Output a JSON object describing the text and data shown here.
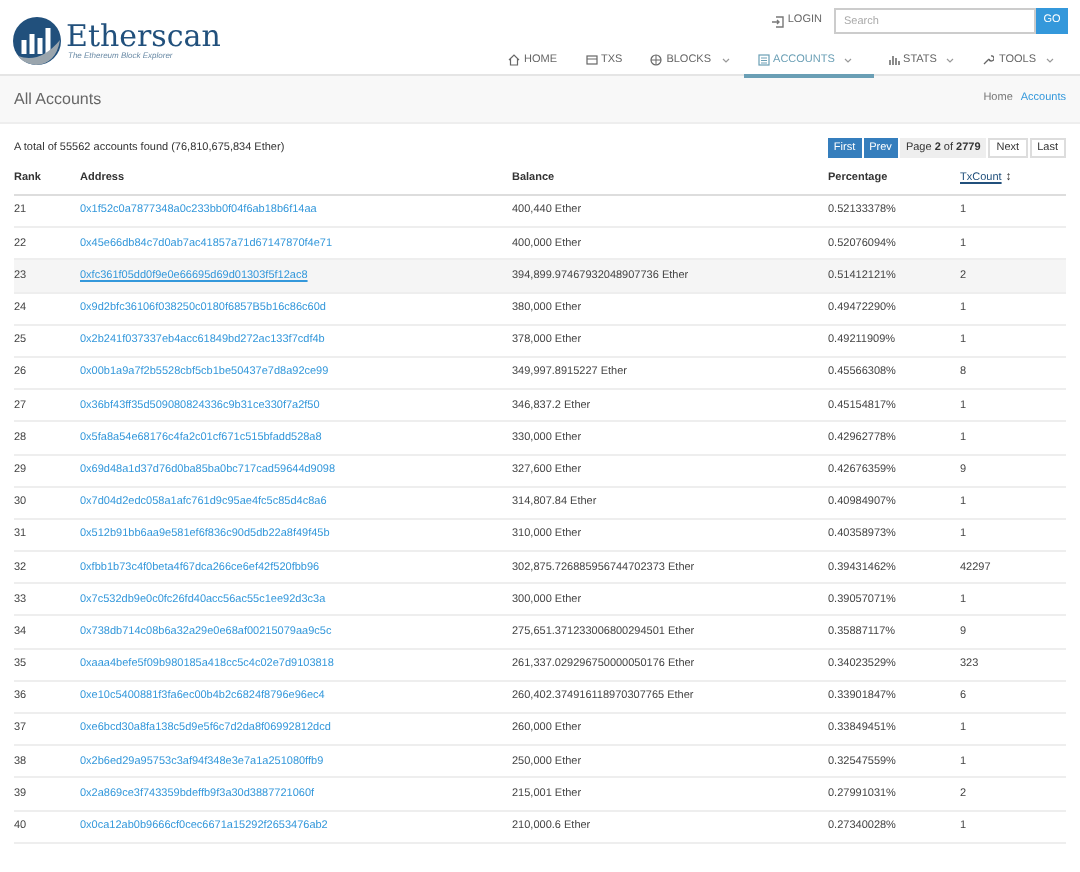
{
  "header": {
    "logo_title": "Etherscan",
    "logo_tagline": "The Ethereum Block Explorer",
    "login": "LOGIN",
    "search": {
      "placeholder": "Search"
    },
    "go": "GO"
  },
  "nav": [
    {
      "label": "HOME",
      "kind": "home",
      "dropdown": false,
      "selected": false
    },
    {
      "label": "TXS",
      "kind": "list",
      "dropdown": false,
      "selected": false
    },
    {
      "label": "BLOCKS",
      "kind": "cube",
      "dropdown": true,
      "selected": false
    },
    {
      "label": "ACCOUNTS",
      "kind": "card",
      "dropdown": true,
      "selected": true
    },
    {
      "label": "STATS",
      "kind": "bars",
      "dropdown": true,
      "selected": false
    },
    {
      "label": "TOOLS",
      "kind": "wrench",
      "dropdown": true,
      "selected": false
    }
  ],
  "page_title": "All Accounts",
  "breadcrumb": [
    "Home",
    "Accounts"
  ],
  "summary": "A total of 55562 accounts found (76,810,675,834 Ether)",
  "pagination": {
    "first": "First",
    "prev": "Prev",
    "page": "Page **2** of **2779**",
    "next": "Next",
    "last": "Last"
  },
  "table": {
    "columns": [
      "Rank",
      "Address",
      "Balance",
      "Percentage",
      "TxCount"
    ],
    "sort_icon": "↕",
    "rows": [
      {
        "rank": "21",
        "address": "0x1f52c0a7877348a0c233bb0f04f6ab18b6f14aa",
        "balance": "400,440 Ether",
        "percentage": "0.52133378%",
        "txcount": "1",
        "selected": false
      },
      {
        "rank": "22",
        "address": "0x45e66db84c7d0ab7ac41857a71d67147870f4e71",
        "balance": "400,000 Ether",
        "percentage": "0.52076094%",
        "txcount": "1",
        "selected": false
      },
      {
        "rank": "23",
        "address": "0xfc361f05dd0f9e0e66695d69d01303f5f12ac8",
        "balance": "394,899.97467932048907736 Ether",
        "percentage": "0.51412121%",
        "txcount": "2",
        "selected": true
      },
      {
        "rank": "24",
        "address": "0x9d2bfc36106f038250c0180f6857B5b16c86c60d",
        "balance": "380,000 Ether",
        "percentage": "0.49472290%",
        "txcount": "1",
        "selected": false
      },
      {
        "rank": "25",
        "address": "0x2b241f037337eb4acc61849bd272ac133f7cdf4b",
        "balance": "378,000 Ether",
        "percentage": "0.49211909%",
        "txcount": "1",
        "selected": false
      },
      {
        "rank": "26",
        "address": "0x00b1a9a7f2b5528cbf5cb1be50437e7d8a92ce99",
        "balance": "349,997.8915227 Ether",
        "percentage": "0.45566308%",
        "txcount": "8",
        "selected": false
      },
      {
        "rank": "27",
        "address": "0x36bf43ff35d509080824336c9b31ce330f7a2f50",
        "balance": "346,837.2 Ether",
        "percentage": "0.45154817%",
        "txcount": "1",
        "selected": false
      },
      {
        "rank": "28",
        "address": "0x5fa8a54e68176c4fa2c01cf671c515bfadd528a8",
        "balance": "330,000 Ether",
        "percentage": "0.42962778%",
        "txcount": "1",
        "selected": false
      },
      {
        "rank": "29",
        "address": "0x69d48a1d37d76d0ba85ba0bc717cad59644d9098",
        "balance": "327,600 Ether",
        "percentage": "0.42676359%",
        "txcount": "9",
        "selected": false
      },
      {
        "rank": "30",
        "address": "0x7d04d2edc058a1afc761d9c95ae4fc5c85d4c8a6",
        "balance": "314,807.84 Ether",
        "percentage": "0.40984907%",
        "txcount": "1",
        "selected": false
      },
      {
        "rank": "31",
        "address": "0x512b91bb6aa9e581ef6f836c90d5db22a8f49f45b",
        "balance": "310,000 Ether",
        "percentage": "0.40358973%",
        "txcount": "1",
        "selected": false
      },
      {
        "rank": "32",
        "address": "0xfbb1b73c4f0beta4f67dca266ce6ef42f520fbb96",
        "balance": "302,875.726885956744702373 Ether",
        "percentage": "0.39431462%",
        "txcount": "42297",
        "selected": false
      },
      {
        "rank": "33",
        "address": "0x7c532db9e0c0fc26fd40acc56ac55c1ee92d3c3a",
        "balance": "300,000 Ether",
        "percentage": "0.39057071%",
        "txcount": "1",
        "selected": false
      },
      {
        "rank": "34",
        "address": "0x738db714c08b6a32a29e0e68af00215079aa9c5c",
        "balance": "275,651.371233006800294501 Ether",
        "percentage": "0.35887117%",
        "txcount": "9",
        "selected": false
      },
      {
        "rank": "35",
        "address": "0xaaa4befe5f09b980185a418cc5c4c02e7d9103818",
        "balance": "261,337.029296750000050176 Ether",
        "percentage": "0.34023529%",
        "txcount": "323",
        "selected": false
      },
      {
        "rank": "36",
        "address": "0xe10c5400881f3fa6ec00b4b2c6824f8796e96ec4",
        "balance": "260,402.374916118970307765 Ether",
        "percentage": "0.33901847%",
        "txcount": "6",
        "selected": false
      },
      {
        "rank": "37",
        "address": "0xe6bcd30a8fa138c5d9e5f6c7d2da8f06992812dcd",
        "balance": "260,000 Ether",
        "percentage": "0.33849451%",
        "txcount": "1",
        "selected": false
      },
      {
        "rank": "38",
        "address": "0x2b6ed29a95753c3af94f348e3e7a1a251080ffb9",
        "balance": "250,000 Ether",
        "percentage": "0.32547559%",
        "txcount": "1",
        "selected": false
      },
      {
        "rank": "39",
        "address": "0x2a869ce3f743359bdeffb9f3a30d3887721060f",
        "balance": "215,001 Ether",
        "percentage": "0.27991031%",
        "txcount": "2",
        "selected": false
      },
      {
        "rank": "40",
        "address": "0x0ca12ab0b9666cf0cec6671a15292f2653476ab2",
        "balance": "210,000.6 Ether",
        "percentage": "0.27340028%",
        "txcount": "1",
        "selected": false
      }
    ]
  }
}
